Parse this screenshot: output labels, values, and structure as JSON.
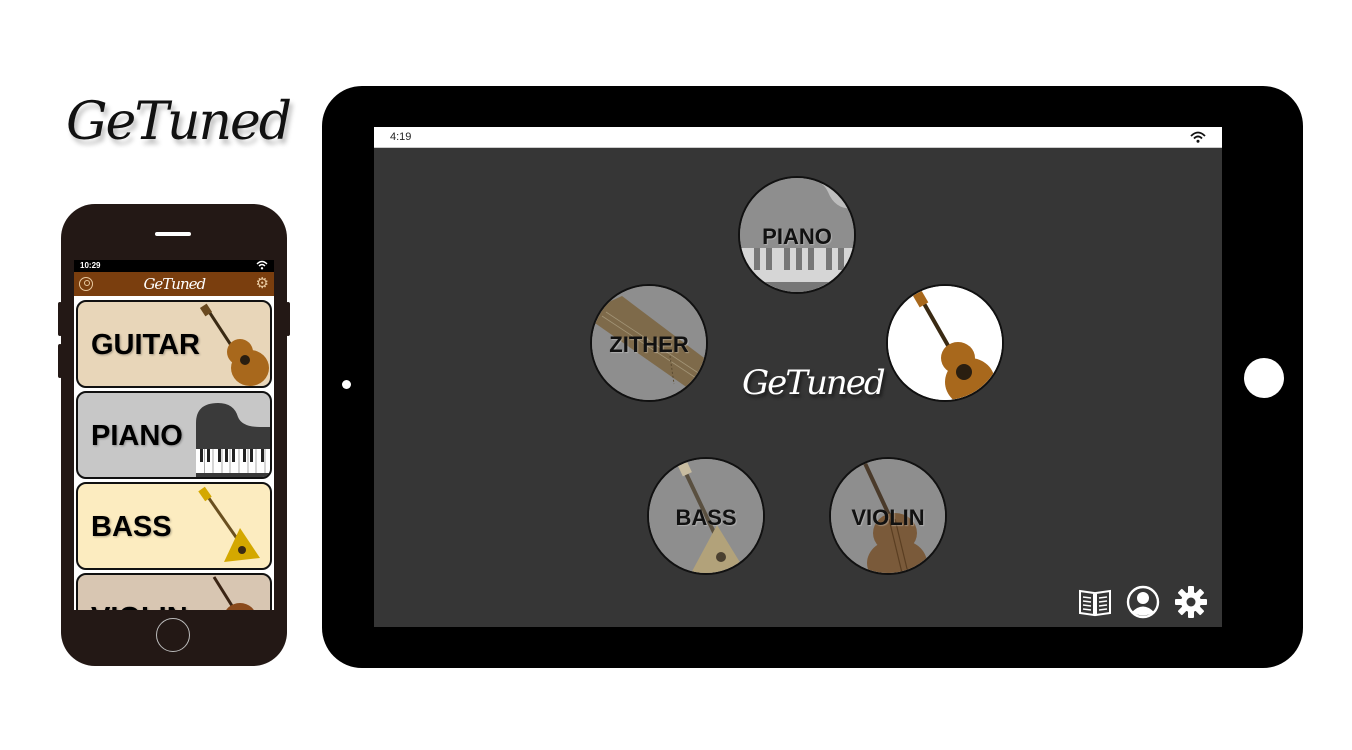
{
  "brand": {
    "logo_text": "GeTuned"
  },
  "phone": {
    "status_time": "10:29",
    "header_logo": "GeTuned",
    "instruments": [
      {
        "label": "GUITAR",
        "bg": "#e8d6b9"
      },
      {
        "label": "PIANO",
        "bg": "#c7c7c7"
      },
      {
        "label": "BASS",
        "bg": "#fcecc0"
      },
      {
        "label": "VIOLIN",
        "bg": "#d8c6b2"
      }
    ]
  },
  "tablet": {
    "status_time": "4:19",
    "logo_text": "GeTuned",
    "instruments": {
      "piano": "PIANO",
      "zither": "ZITHER",
      "guitar": "",
      "bass": "BASS",
      "violin": "VIOLIN"
    },
    "toolbar": [
      "book-icon",
      "profile-icon",
      "settings-icon"
    ]
  },
  "colors": {
    "phone_header": "#7a3e0e",
    "tablet_screen": "#363636",
    "wood": "#a8681c"
  }
}
